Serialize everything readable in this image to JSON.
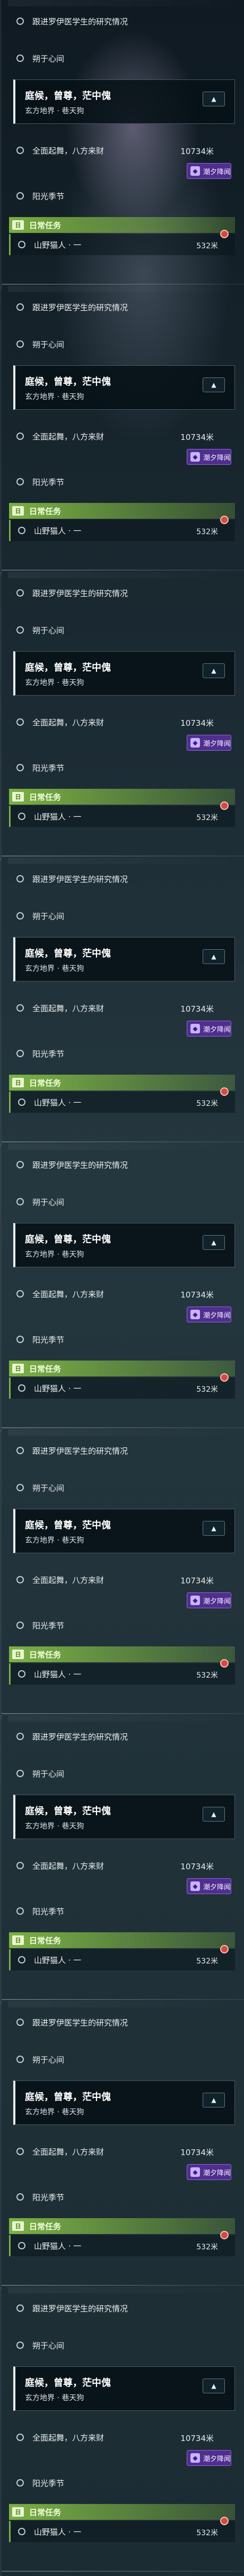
{
  "quests": {
    "quest1": "跟进罗伊医学生的研究情况",
    "quest2": "朔于心间",
    "tracked_title": "庭候，曾尊，茫中傀",
    "tracked_location": "玄方地界 · 巷天狗",
    "quest3": "全面起舞，八方来财",
    "quest3_distance": "10734米",
    "badge_label": "潮夕降闻",
    "quest4": "阳光季节"
  },
  "daily": {
    "header": "日常任务",
    "item": "山野猫人 · 一",
    "item_distance": "532米"
  },
  "colors": {
    "daily_green": "#8cc846",
    "badge_purple": "#4f2e8f",
    "alert_red": "#d6493e"
  },
  "icons": [
    "radio-circle-icon",
    "chevron-up-icon",
    "daily-task-icon",
    "tide-event-icon",
    "alert-dot-icon"
  ]
}
